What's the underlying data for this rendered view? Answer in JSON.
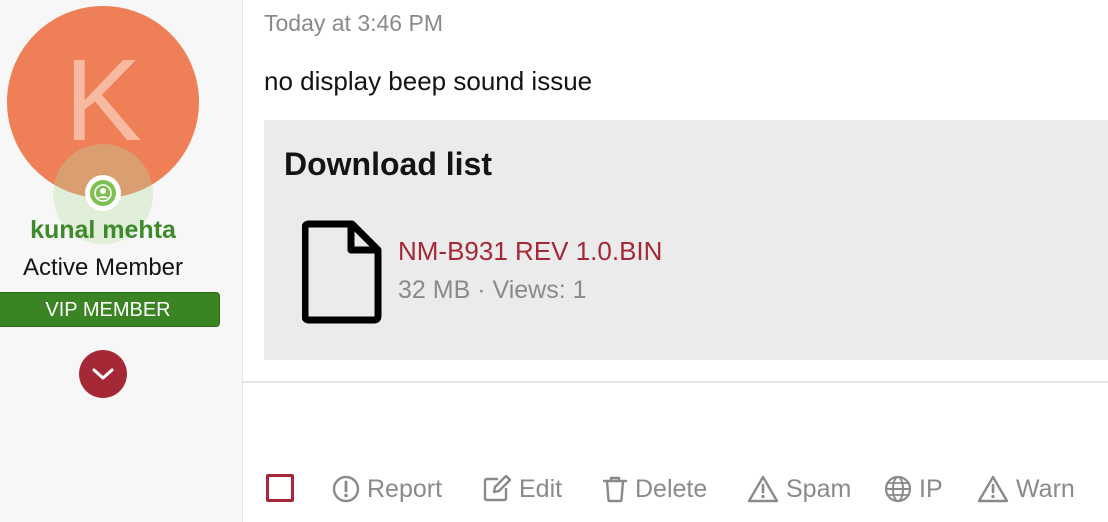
{
  "user": {
    "avatar_letter": "K",
    "avatar_color": "#ef7f57",
    "online_status_icon": "user-online-icon",
    "name": "kunal mehta",
    "name_color": "#3d8a2b",
    "title": "Active Member",
    "banner": "VIP MEMBER",
    "banner_color": "#3a8424",
    "expand_icon": "chevron-down-icon"
  },
  "post": {
    "timestamp": "Today at 3:46 PM",
    "message": "no display beep sound issue",
    "attachments": {
      "title": "Download list",
      "files": [
        {
          "icon": "file-icon",
          "name": "NM-B931 REV 1.0.BIN",
          "meta": "32 MB · Views: 1"
        }
      ]
    }
  },
  "actions": {
    "select_checkbox": "select-checkbox",
    "report": "Report",
    "edit": "Edit",
    "delete": "Delete",
    "spam": "Spam",
    "ip": "IP",
    "warn": "Warn"
  },
  "colors": {
    "accent": "#a52836",
    "muted_text": "#8a8a8a",
    "online": "#7ec050"
  }
}
